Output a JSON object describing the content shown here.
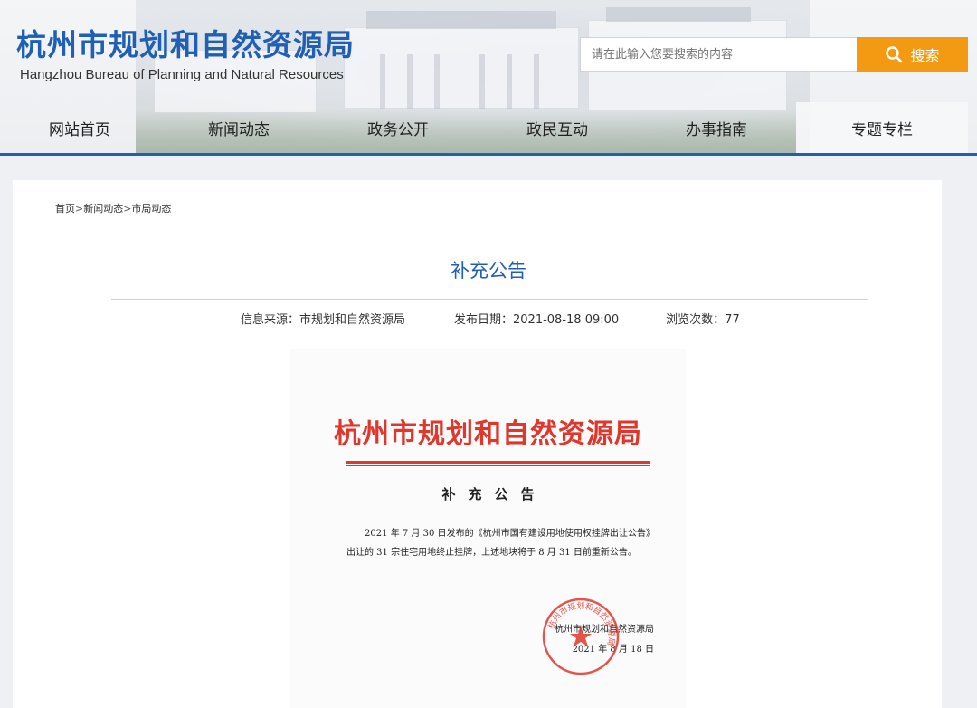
{
  "header": {
    "site_title": "杭州市规划和自然资源局",
    "site_title_en": "Hangzhou Bureau of Planning and Natural Resources",
    "search": {
      "placeholder": "请在此输入您要搜索的内容",
      "value": "",
      "button_label": "搜索",
      "button_icon": "search-icon"
    }
  },
  "nav": {
    "items": [
      {
        "label": "网站首页"
      },
      {
        "label": "新闻动态"
      },
      {
        "label": "政务公开"
      },
      {
        "label": "政民互动"
      },
      {
        "label": "办事指南"
      },
      {
        "label": "专题专栏"
      }
    ]
  },
  "breadcrumb": {
    "items": [
      "首页",
      "新闻动态",
      "市局动态"
    ],
    "separator": ">"
  },
  "article": {
    "title": "补充公告",
    "meta": {
      "source": "信息来源：市规划和自然资源局",
      "date": "发布日期：2021-08-18 09:00",
      "views": "浏览次数：77"
    }
  },
  "document": {
    "letterhead": "杭州市规划和自然资源局",
    "subtitle": "补充公告",
    "body": "2021 年 7 月 30 日发布的《杭州市国有建设用地使用权挂牌出让公告》出让的 31 宗住宅用地终止挂牌，上述地块将于 8 月 31 日前重新公告。",
    "signatory": "杭州市规划和自然资源局",
    "date": "2021 年 8 月 18 日",
    "seal_text": "杭州市规划和自然资源局"
  },
  "colors": {
    "brand_blue": "#1f5fb4",
    "search_orange": "#f39a12",
    "doc_red": "#e0362c"
  }
}
